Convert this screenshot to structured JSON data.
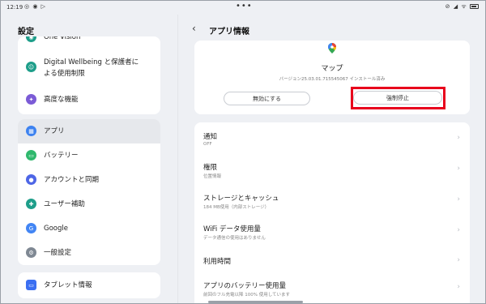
{
  "status_bar": {
    "time": "12:19",
    "left_icons": "◎ ◉ ▷",
    "center_dots": "•••",
    "right_icons": "⊘ ◢ ᯤ"
  },
  "left": {
    "title": "設定",
    "card1_items": [
      {
        "label": "One Vision",
        "icon": "vision-icon"
      },
      {
        "label": "Digital Wellbeing と保護者による使用制限",
        "line1": "Digital Wellbeing と保護者に",
        "line2": "よる使用制限",
        "icon": "wellbeing-icon"
      },
      {
        "label": "高度な機能",
        "icon": "advanced-icon"
      }
    ],
    "card2_items": [
      {
        "label": "アプリ",
        "icon": "apps-icon",
        "active": true
      },
      {
        "label": "バッテリー",
        "icon": "battery-icon"
      },
      {
        "label": "アカウントと同期",
        "icon": "account-icon"
      },
      {
        "label": "ユーザー補助",
        "icon": "accessibility-icon"
      },
      {
        "label": "Google",
        "icon": "google-icon"
      },
      {
        "label": "一般設定",
        "icon": "gear-icon"
      }
    ],
    "card3_items": [
      {
        "label": "タブレット情報",
        "icon": "tablet-icon"
      }
    ]
  },
  "right": {
    "title": "アプリ情報",
    "app_name": "マップ",
    "version": "バージョン25.03.01.715545067 インストール済み",
    "disable_label": "無効にする",
    "force_stop_label": "強制停止",
    "rows": [
      {
        "title": "通知",
        "subtitle": "OFF"
      },
      {
        "title": "権限",
        "subtitle": "位置情報"
      },
      {
        "title": "ストレージとキャッシュ",
        "subtitle": "184 MB使用（内部ストレージ）"
      },
      {
        "title": "WiFi データ使用量",
        "subtitle": "データ通信の使用はありません"
      },
      {
        "title": "利用時間",
        "subtitle": ""
      },
      {
        "title": "アプリのバッテリー使用量",
        "subtitle": "前回のフル充電以降 100% 使用しています"
      }
    ]
  },
  "colors": {
    "highlight": "#e8001c",
    "background": "#eef0f4",
    "card": "#ffffff"
  }
}
